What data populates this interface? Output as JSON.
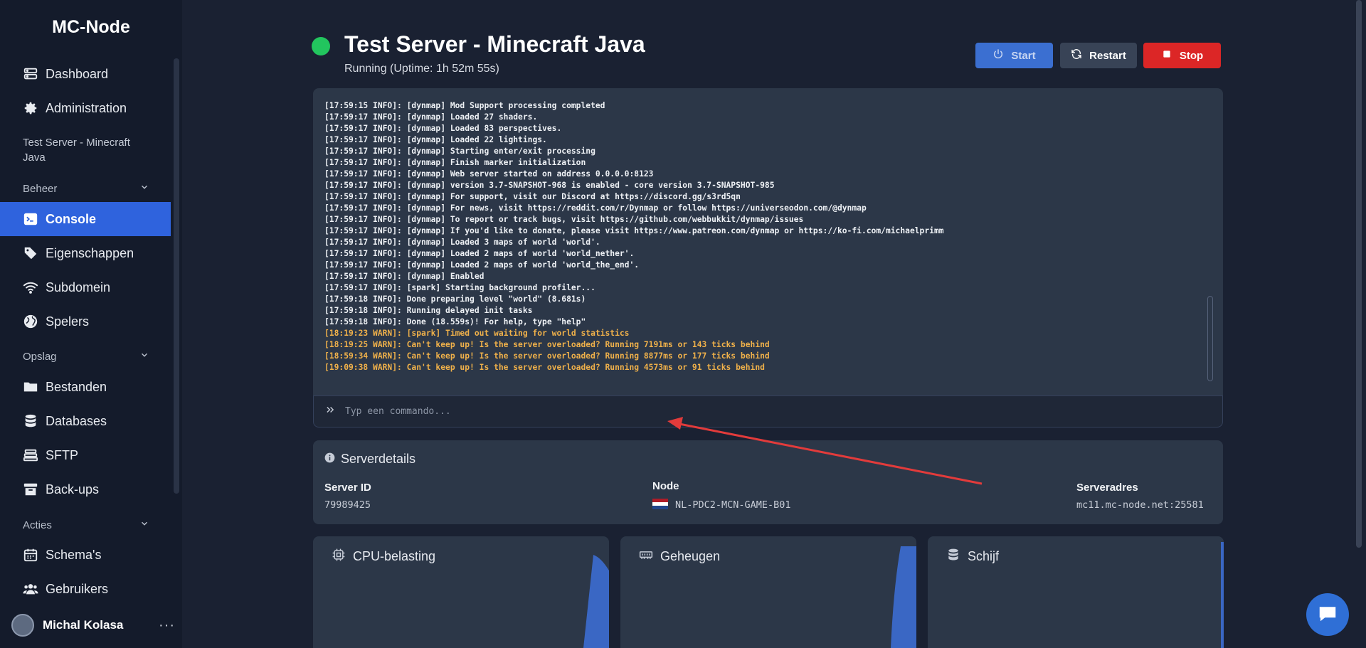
{
  "app": {
    "brand": "MC-Node"
  },
  "sidebar": {
    "items": [
      {
        "label": "Dashboard",
        "icon": "server-icon"
      },
      {
        "label": "Administration",
        "icon": "gear-icon"
      }
    ],
    "server_name": "Test Server - Minecraft Java",
    "sections": {
      "beheer": "Beheer",
      "opslag": "Opslag",
      "acties": "Acties"
    },
    "beheer_items": [
      {
        "label": "Console",
        "icon": "terminal-icon",
        "active": true
      },
      {
        "label": "Eigenschappen",
        "icon": "tag-icon"
      },
      {
        "label": "Subdomein",
        "icon": "wifi-icon"
      },
      {
        "label": "Spelers",
        "icon": "globe-icon"
      }
    ],
    "opslag_items": [
      {
        "label": "Bestanden",
        "icon": "folder-icon"
      },
      {
        "label": "Databases",
        "icon": "database-icon"
      },
      {
        "label": "SFTP",
        "icon": "stack-icon"
      },
      {
        "label": "Back-ups",
        "icon": "archive-icon"
      }
    ],
    "acties_items": [
      {
        "label": "Schema's",
        "icon": "calendar-icon"
      },
      {
        "label": "Gebruikers",
        "icon": "users-icon"
      }
    ],
    "user": {
      "name": "Michal Kolasa",
      "menu": "···"
    }
  },
  "header": {
    "title": "Test Server - Minecraft Java",
    "uptime": "Running (Uptime: 1h 52m 55s)",
    "status_color": "#22c55e",
    "buttons": {
      "start": "Start",
      "restart": "Restart",
      "stop": "Stop"
    }
  },
  "console": {
    "lines": [
      {
        "text": "[17:59:15 INFO]: [dynmap] Mod Support processing completed",
        "level": "info"
      },
      {
        "text": "[17:59:17 INFO]: [dynmap] Loaded 27 shaders.",
        "level": "info"
      },
      {
        "text": "[17:59:17 INFO]: [dynmap] Loaded 83 perspectives.",
        "level": "info"
      },
      {
        "text": "[17:59:17 INFO]: [dynmap] Loaded 22 lightings.",
        "level": "info"
      },
      {
        "text": "[17:59:17 INFO]: [dynmap] Starting enter/exit processing",
        "level": "info"
      },
      {
        "text": "[17:59:17 INFO]: [dynmap] Finish marker initialization",
        "level": "info"
      },
      {
        "text": "[17:59:17 INFO]: [dynmap] Web server started on address 0.0.0.0:8123",
        "level": "info"
      },
      {
        "text": "[17:59:17 INFO]: [dynmap] version 3.7-SNAPSHOT-968 is enabled - core version 3.7-SNAPSHOT-985",
        "level": "info"
      },
      {
        "text": "[17:59:17 INFO]: [dynmap] For support, visit our Discord at https://discord.gg/s3rd5qn",
        "level": "info"
      },
      {
        "text": "[17:59:17 INFO]: [dynmap] For news, visit https://reddit.com/r/Dynmap or follow https://universeodon.com/@dynmap",
        "level": "info"
      },
      {
        "text": "[17:59:17 INFO]: [dynmap] To report or track bugs, visit https://github.com/webbukkit/dynmap/issues",
        "level": "info"
      },
      {
        "text": "[17:59:17 INFO]: [dynmap] If you'd like to donate, please visit https://www.patreon.com/dynmap or https://ko-fi.com/michaelprimm",
        "level": "info"
      },
      {
        "text": "[17:59:17 INFO]: [dynmap] Loaded 3 maps of world 'world'.",
        "level": "info"
      },
      {
        "text": "[17:59:17 INFO]: [dynmap] Loaded 2 maps of world 'world_nether'.",
        "level": "info"
      },
      {
        "text": "[17:59:17 INFO]: [dynmap] Loaded 2 maps of world 'world_the_end'.",
        "level": "info"
      },
      {
        "text": "[17:59:17 INFO]: [dynmap] Enabled",
        "level": "info"
      },
      {
        "text": "[17:59:17 INFO]: [spark] Starting background profiler...",
        "level": "info"
      },
      {
        "text": "[17:59:18 INFO]: Done preparing level \"world\" (8.681s)",
        "level": "info"
      },
      {
        "text": "[17:59:18 INFO]: Running delayed init tasks",
        "level": "info"
      },
      {
        "text": "[17:59:18 INFO]: Done (18.559s)! For help, type \"help\"",
        "level": "info"
      },
      {
        "text": "[18:19:23 WARN]: [spark] Timed out waiting for world statistics",
        "level": "warn"
      },
      {
        "text": "[18:19:25 WARN]: Can't keep up! Is the server overloaded? Running 7191ms or 143 ticks behind",
        "level": "warn"
      },
      {
        "text": "[18:59:34 WARN]: Can't keep up! Is the server overloaded? Running 8877ms or 177 ticks behind",
        "level": "warn"
      },
      {
        "text": "[19:09:38 WARN]: Can't keep up! Is the server overloaded? Running 4573ms or 91 ticks behind",
        "level": "warn"
      }
    ],
    "command_placeholder": "Typ een commando..."
  },
  "details": {
    "title": "Serverdetails",
    "server_id_label": "Server ID",
    "server_id": "79989425",
    "node_label": "Node",
    "node": "NL-PDC2-MCN-GAME-B01",
    "address_label": "Serveradres",
    "address": "mc11.mc-node.net:25581"
  },
  "stats": {
    "cpu": "CPU-belasting",
    "memory": "Geheugen",
    "disk": "Schijf",
    "accent": "#3a67c4"
  }
}
